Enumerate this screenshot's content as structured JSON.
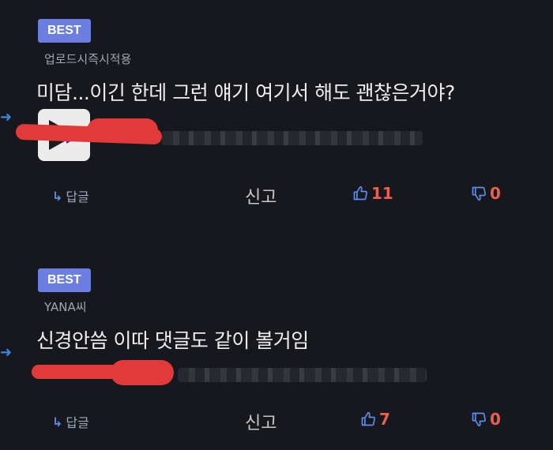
{
  "comments": [
    {
      "badge": "BEST",
      "author": "업로드시즉시적용",
      "text": "미담...이긴 한데 그런 얘기 여기서 해도 괜찮은거야?",
      "reply_label": "답글",
      "report_label": "신고",
      "likes": "11",
      "dislikes": "0"
    },
    {
      "badge": "BEST",
      "author": "YANA씨",
      "text": "신경안씀 이따 댓글도 같이 볼거임",
      "reply_label": "답글",
      "report_label": "신고",
      "likes": "7",
      "dislikes": "0"
    }
  ],
  "icons": {
    "reply": "reply-arrow-icon",
    "like": "thumbs-up-icon",
    "dislike": "thumbs-down-icon",
    "side": "right-arrow-icon"
  },
  "colors": {
    "background": "#16181d",
    "badge": "#6c7fe0",
    "accent_blue": "#5b8ef0",
    "count_red": "#e9604f",
    "redaction": "#e23a3a"
  }
}
